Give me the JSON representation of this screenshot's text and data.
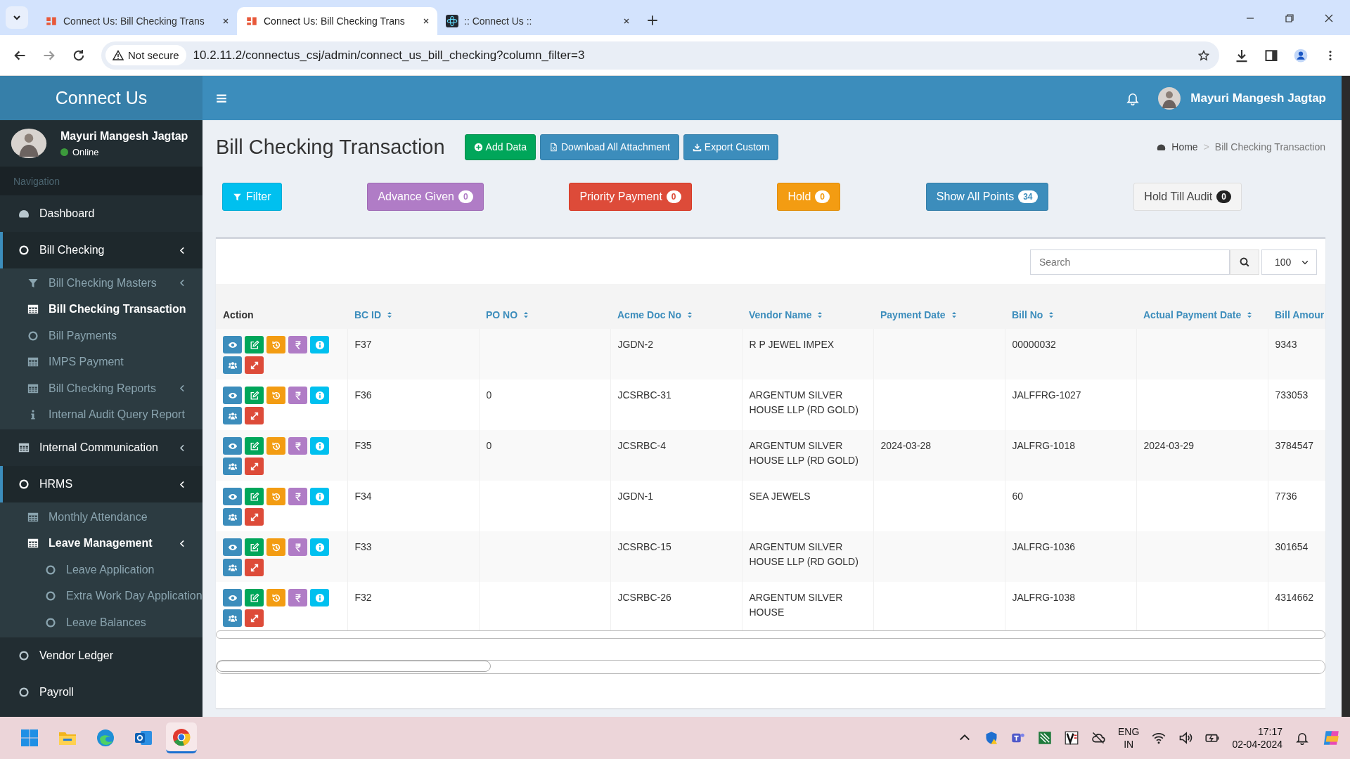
{
  "browser": {
    "tabs": [
      {
        "title": "Connect Us: Bill Checking Trans",
        "kind": "app",
        "selected": false
      },
      {
        "title": "Connect Us: Bill Checking Trans",
        "kind": "app",
        "selected": true
      },
      {
        "title": ":: Connect Us ::",
        "kind": "atom",
        "selected": false
      }
    ],
    "security_label": "Not secure",
    "url": "10.2.11.2/connectus_csj/admin/connect_us_bill_checking?column_filter=3"
  },
  "sidebar": {
    "brand": "Connect Us",
    "user": {
      "name": "Mayuri Mangesh Jagtap",
      "status": "Online"
    },
    "nav_header": "Navigation",
    "items": [
      {
        "label": "Dashboard",
        "kind": "dashboard"
      },
      {
        "label": "Bill Checking",
        "kind": "circle",
        "expanded": true,
        "children": [
          {
            "label": "Bill Checking Masters",
            "kind": "filter",
            "selected": false,
            "expanded": false
          },
          {
            "label": "Bill Checking Transaction",
            "kind": "table",
            "selected": true
          },
          {
            "label": "Bill Payments",
            "kind": "circle",
            "selected": false
          },
          {
            "label": "IMPS Payment",
            "kind": "table",
            "selected": false
          },
          {
            "label": "Bill Checking Reports",
            "kind": "table",
            "selected": false,
            "expanded": false
          },
          {
            "label": "Internal Audit Query Report",
            "kind": "info",
            "selected": false
          }
        ]
      },
      {
        "label": "Internal Communication",
        "kind": "table",
        "expanded": false
      },
      {
        "label": "HRMS",
        "kind": "circle",
        "expanded": true,
        "children": [
          {
            "label": "Monthly Attendance",
            "kind": "table",
            "selected": false
          },
          {
            "label": "Leave Management",
            "kind": "table",
            "expanded": true,
            "children": [
              {
                "label": "Leave Application",
                "kind": "circle",
                "selected": false
              },
              {
                "label": "Extra Work Day Application",
                "kind": "circle",
                "selected": false
              },
              {
                "label": "Leave Balances",
                "kind": "circle",
                "selected": false
              }
            ]
          }
        ]
      },
      {
        "label": "Vendor Ledger",
        "kind": "circle"
      },
      {
        "label": "Payroll",
        "kind": "circle"
      }
    ]
  },
  "header": {
    "user_name": "Mayuri Mangesh Jagtap"
  },
  "page": {
    "title": "Bill Checking Transaction",
    "actions": [
      {
        "label": "Add Data",
        "kind": "add"
      },
      {
        "label": "Download All Attachment",
        "kind": "file"
      },
      {
        "label": "Export Custom",
        "kind": "download"
      }
    ],
    "breadcrumb": {
      "items": [
        "Home",
        "Bill Checking Transaction"
      ],
      "separator": ">"
    }
  },
  "filters": [
    {
      "label": "Filter",
      "kind": "filter"
    },
    {
      "label": "Advance Given",
      "count": "0",
      "kind": "purple"
    },
    {
      "label": "Priority Payment",
      "count": "0",
      "kind": "red"
    },
    {
      "label": "Hold",
      "count": "0",
      "kind": "orange"
    },
    {
      "label": "Show All Points",
      "count": "34",
      "kind": "blue"
    },
    {
      "label": "Hold Till Audit",
      "count": "0",
      "kind": "default"
    }
  ],
  "table": {
    "search": {
      "placeholder": "Search"
    },
    "page_size": "100",
    "columns": [
      {
        "label": "Action",
        "sortable": false
      },
      {
        "label": "BC ID",
        "sortable": true
      },
      {
        "label": "PO NO",
        "sortable": true
      },
      {
        "label": "Acme Doc No",
        "sortable": true
      },
      {
        "label": "Vendor Name",
        "sortable": true
      },
      {
        "label": "Payment Date",
        "sortable": true
      },
      {
        "label": "Bill No",
        "sortable": true
      },
      {
        "label": "Actual Payment Date",
        "sortable": true
      },
      {
        "label": "Bill Amour"
      }
    ],
    "row_actions": [
      {
        "kind": "view"
      },
      {
        "kind": "edit"
      },
      {
        "kind": "history"
      },
      {
        "kind": "payment"
      },
      {
        "kind": "info"
      },
      {
        "kind": "users"
      },
      {
        "kind": "expand"
      }
    ],
    "rows": [
      {
        "cells": [
          null,
          "F37",
          null,
          "JGDN-2",
          "R P JEWEL IMPEX",
          null,
          "00000032",
          null,
          "9343"
        ]
      },
      {
        "cells": [
          null,
          "F36",
          "0",
          "JCSRBC-31",
          "ARGENTUM SILVER HOUSE LLP (RD GOLD)",
          null,
          "JALFFRG-1027",
          null,
          "733053"
        ]
      },
      {
        "cells": [
          null,
          "F35",
          "0",
          "JCSRBC-4",
          "ARGENTUM SILVER HOUSE LLP (RD GOLD)",
          "2024-03-28",
          "JALFRG-1018",
          "2024-03-29",
          "3784547"
        ]
      },
      {
        "cells": [
          null,
          "F34",
          null,
          "JGDN-1",
          "SEA JEWELS",
          null,
          "60",
          null,
          "7736"
        ]
      },
      {
        "cells": [
          null,
          "F33",
          null,
          "JCSRBC-15",
          "ARGENTUM SILVER HOUSE LLP (RD GOLD)",
          null,
          "JALFRG-1036",
          null,
          "301654"
        ]
      },
      {
        "cells": [
          null,
          "F32",
          null,
          "JCSRBC-26",
          "ARGENTUM SILVER HOUSE",
          null,
          "JALFRG-1038",
          null,
          "4314662"
        ]
      }
    ]
  },
  "taskbar": {
    "apps": [
      {
        "kind": "start",
        "selected": false
      },
      {
        "kind": "folder",
        "selected": false
      },
      {
        "kind": "edge",
        "selected": false
      },
      {
        "kind": "outlook",
        "selected": false
      },
      {
        "kind": "chrome",
        "selected": true
      }
    ],
    "language": [
      "ENG",
      "IN"
    ],
    "time": "17:17",
    "date": "02-04-2024"
  }
}
